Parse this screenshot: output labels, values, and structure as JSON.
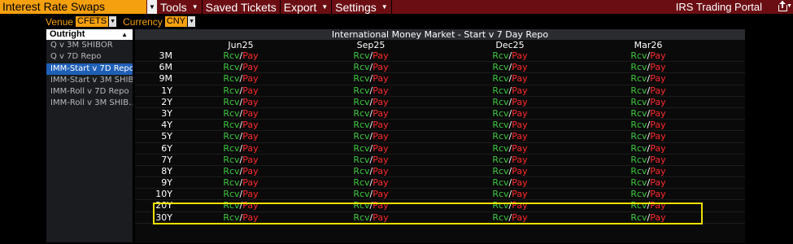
{
  "menubar": {
    "title": "Interest Rate Swaps",
    "items": [
      {
        "label": "Tools"
      },
      {
        "label": "Saved Tickets"
      },
      {
        "label": "Export"
      },
      {
        "label": "Settings"
      }
    ],
    "portal": "IRS Trading Portal"
  },
  "filters": {
    "venue_label": "Venue",
    "venue_value": "CFETS",
    "currency_label": "Currency",
    "currency_value": "CNY"
  },
  "sidebar": {
    "header": "Outright",
    "items": [
      {
        "label": "Q v 3M SHIBOR",
        "active": false
      },
      {
        "label": "Q v 7D Repo",
        "active": false
      },
      {
        "label": "IMM-Start v 7D Repo",
        "active": true
      },
      {
        "label": "IMM-Start v 3M SHIB…",
        "active": false
      },
      {
        "label": "IMM-Roll v 7D Repo",
        "active": false
      },
      {
        "label": "IMM-Roll v 3M SHIB…",
        "active": false
      }
    ]
  },
  "grid": {
    "title": "International Money Market - Start v 7 Day Repo",
    "columns": [
      "Jun25",
      "Sep25",
      "Dec25",
      "Mar26"
    ],
    "receive_label": "Rcv",
    "separator": "/",
    "pay_label": "Pay",
    "tenors": [
      "3M",
      "6M",
      "9M",
      "1Y",
      "2Y",
      "3Y",
      "4Y",
      "5Y",
      "6Y",
      "7Y",
      "8Y",
      "9Y",
      "10Y",
      "20Y",
      "30Y"
    ]
  },
  "colors": {
    "menubar": "#6b0e13",
    "accent": "#f5a00f",
    "receive": "#3ec83e",
    "pay": "#ff2a2a",
    "active": "#1f5fb6",
    "highlight": "#f0e000"
  }
}
